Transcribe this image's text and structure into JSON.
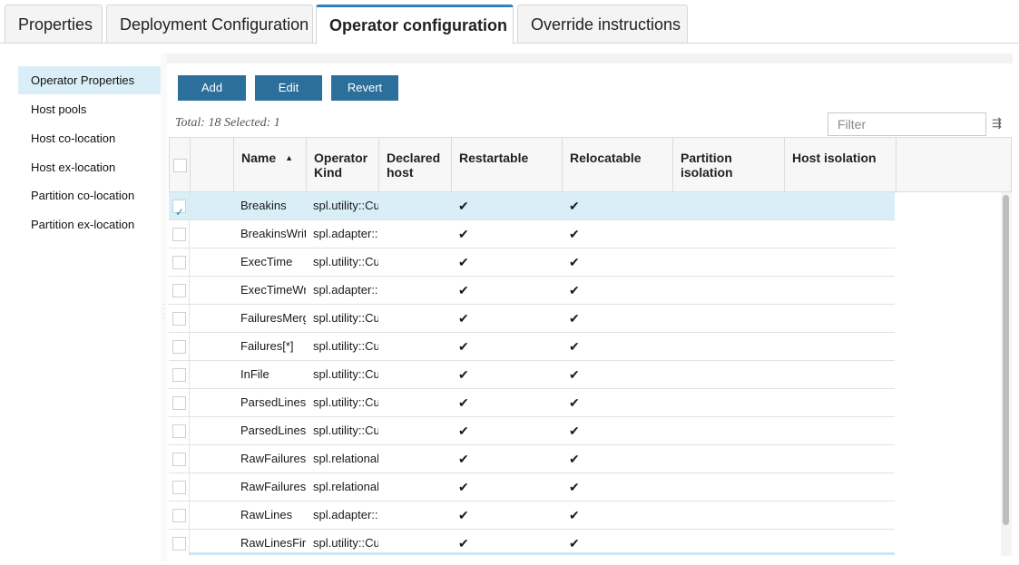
{
  "tabs": [
    {
      "label": "Properties",
      "active": false
    },
    {
      "label": "Deployment Configuration",
      "active": false
    },
    {
      "label": "Operator configuration",
      "active": true
    },
    {
      "label": "Override instructions",
      "active": false
    }
  ],
  "sidebar": {
    "items": [
      {
        "label": "Operator Properties",
        "active": true
      },
      {
        "label": "Host pools",
        "active": false
      },
      {
        "label": "Host co-location",
        "active": false
      },
      {
        "label": "Host ex-location",
        "active": false
      },
      {
        "label": "Partition co-location",
        "active": false
      },
      {
        "label": "Partition ex-location",
        "active": false
      }
    ]
  },
  "toolbar": {
    "add_label": "Add",
    "edit_label": "Edit",
    "revert_label": "Revert"
  },
  "summary": "Total: 18 Selected: 1",
  "filter": {
    "placeholder": "Filter",
    "icon": "filter-arrows-icon"
  },
  "table": {
    "columns": [
      "",
      "",
      "Name",
      "Operator Kind",
      "Declared host",
      "Restartable",
      "Relocatable",
      "Partition isolation",
      "Host isolation"
    ],
    "sort": {
      "column": "Name",
      "direction": "ascending"
    },
    "check_glyph": "✔",
    "rows": [
      {
        "checked": true,
        "name": "Breakins",
        "kind": "spl.utility::Cu",
        "declared_host": "",
        "restartable": true,
        "relocatable": true,
        "partition_isolation": "",
        "host_isolation": ""
      },
      {
        "checked": false,
        "name": "BreakinsWrit",
        "kind": "spl.adapter::",
        "declared_host": "",
        "restartable": true,
        "relocatable": true,
        "partition_isolation": "",
        "host_isolation": ""
      },
      {
        "checked": false,
        "name": "ExecTime",
        "kind": "spl.utility::Cu",
        "declared_host": "",
        "restartable": true,
        "relocatable": true,
        "partition_isolation": "",
        "host_isolation": ""
      },
      {
        "checked": false,
        "name": "ExecTimeWr",
        "kind": "spl.adapter::",
        "declared_host": "",
        "restartable": true,
        "relocatable": true,
        "partition_isolation": "",
        "host_isolation": ""
      },
      {
        "checked": false,
        "name": "FailuresMerg",
        "kind": "spl.utility::Cu",
        "declared_host": "",
        "restartable": true,
        "relocatable": true,
        "partition_isolation": "",
        "host_isolation": ""
      },
      {
        "checked": false,
        "name": "Failures[*]",
        "kind": "spl.utility::Cu",
        "declared_host": "",
        "restartable": true,
        "relocatable": true,
        "partition_isolation": "",
        "host_isolation": ""
      },
      {
        "checked": false,
        "name": "InFile",
        "kind": "spl.utility::Cu",
        "declared_host": "",
        "restartable": true,
        "relocatable": true,
        "partition_isolation": "",
        "host_isolation": ""
      },
      {
        "checked": false,
        "name": "ParsedLines",
        "kind": "spl.utility::Cu",
        "declared_host": "",
        "restartable": true,
        "relocatable": true,
        "partition_isolation": "",
        "host_isolation": ""
      },
      {
        "checked": false,
        "name": "ParsedLines",
        "kind": "spl.utility::Cu",
        "declared_host": "",
        "restartable": true,
        "relocatable": true,
        "partition_isolation": "",
        "host_isolation": ""
      },
      {
        "checked": false,
        "name": "RawFailures",
        "kind": "spl.relational",
        "declared_host": "",
        "restartable": true,
        "relocatable": true,
        "partition_isolation": "",
        "host_isolation": ""
      },
      {
        "checked": false,
        "name": "RawFailures",
        "kind": "spl.relational",
        "declared_host": "",
        "restartable": true,
        "relocatable": true,
        "partition_isolation": "",
        "host_isolation": ""
      },
      {
        "checked": false,
        "name": "RawLines",
        "kind": "spl.adapter::",
        "declared_host": "",
        "restartable": true,
        "relocatable": true,
        "partition_isolation": "",
        "host_isolation": ""
      },
      {
        "checked": false,
        "name": "RawLinesFir",
        "kind": "spl.utility::Cu",
        "declared_host": "",
        "restartable": true,
        "relocatable": true,
        "partition_isolation": "",
        "host_isolation": ""
      }
    ]
  },
  "colors": {
    "accent": "#2f7fc1",
    "button": "#2d6f9b",
    "selected_row": "#daeef8"
  }
}
